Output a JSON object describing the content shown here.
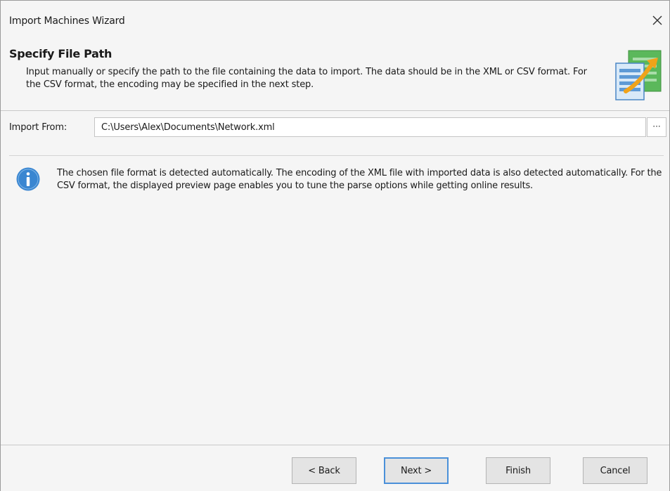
{
  "window": {
    "title": "Import Machines Wizard"
  },
  "header": {
    "title": "Specify File Path",
    "description": "Input manually or specify the path to the file containing the data to import. The data should be in the XML or CSV format. For the CSV format, the encoding may be specified in the next step.",
    "icon": "import-spreadsheet-icon"
  },
  "form": {
    "import_label": "Import From:",
    "path_value": "C:\\Users\\Alex\\Documents\\Network.xml",
    "browse_label": "···"
  },
  "info": {
    "icon": "info-icon",
    "text": "The chosen file format is detected automatically. The encoding of the XML file with imported data is also detected automatically. For the CSV format, the displayed preview page enables you to tune the parse options while getting online results."
  },
  "buttons": {
    "back": "< Back",
    "next": "Next >",
    "finish": "Finish",
    "cancel": "Cancel"
  },
  "colors": {
    "accent": "#4a90d9",
    "info_blue": "#3a86d1",
    "icon_green": "#5bb85b"
  }
}
